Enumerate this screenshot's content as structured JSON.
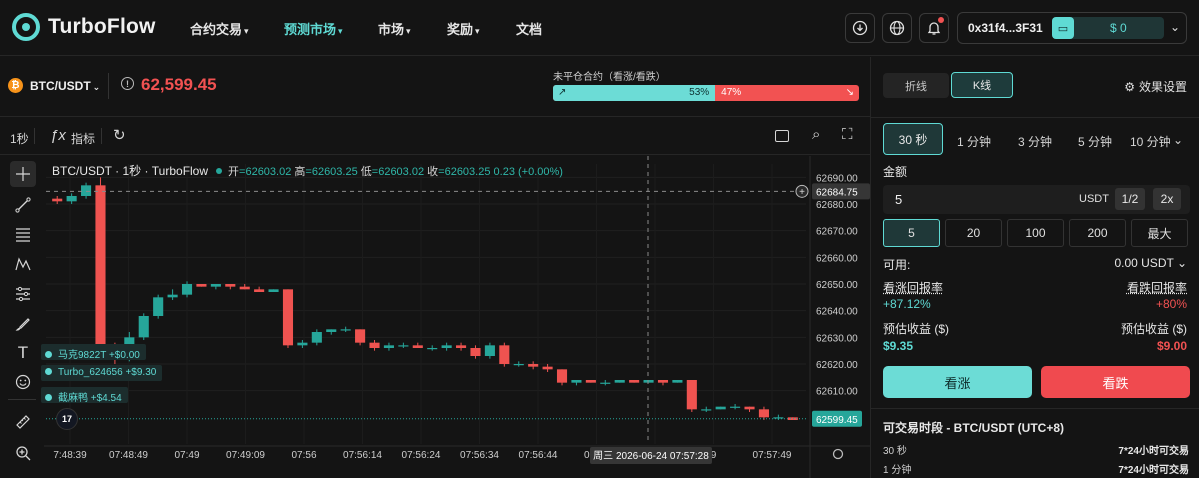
{
  "nav": {
    "brand": "TurboFlow",
    "items": [
      {
        "label": "合约交易",
        "caret": "▾"
      },
      {
        "label": "预测市场",
        "caret": "▾"
      },
      {
        "label": "市场",
        "caret": "▾"
      },
      {
        "label": "奖励",
        "caret": "▾"
      },
      {
        "label": "文档",
        "caret": ""
      }
    ],
    "active_index": 1,
    "wallet": {
      "address": "0x31f4...3F31",
      "balance": "$ 0"
    }
  },
  "symbol": {
    "name": "BTC/USDT",
    "price": "62,599.45",
    "coin_glyph": "₿"
  },
  "open_interest": {
    "label": "未平仓合约（看涨/看跌）",
    "up_pct_text": "53%",
    "down_pct_text": "47%",
    "up_fraction": 0.53
  },
  "chart_toolbar": {
    "interval": "1秒",
    "indicators": "指标"
  },
  "legend": {
    "title": "BTC/USDT · 1秒 · TurboFlow",
    "open_k": "开",
    "open_v": "=62603.02",
    "high_k": "高",
    "high_v": "=62603.25",
    "low_k": "低",
    "low_v": "=62603.02",
    "close_k": "收",
    "close_v": "=62603.25",
    "change": "0.23 (+0.00%)"
  },
  "trade_tags": [
    {
      "text": "马克9822T +$0.00"
    },
    {
      "text": "Turbo_624656 +$9.30"
    },
    {
      "text": "截麻鸭 +$4.54"
    }
  ],
  "chart_data": {
    "type": "candlestick",
    "ylim": [
      62590,
      62695
    ],
    "y_ticks": [
      62690,
      62680,
      62670,
      62660,
      62650,
      62640,
      62630,
      62620,
      62610
    ],
    "crosshair_value": "62684.75",
    "last_price_label": "62599.45",
    "last_price": 62599.45,
    "x_ticks": [
      "7:48:39",
      "07:48:49",
      "07:49",
      "07:49:09",
      "07:56",
      "07:56:14",
      "07:56:24",
      "07:56:34",
      "07:56:44",
      "07:57",
      "07:57:09",
      "9",
      "07:57:49"
    ],
    "crosshair_time": "周三 2026-06-24 07:57:28",
    "candles": [
      [
        62682,
        62683,
        62680,
        62681
      ],
      [
        62681,
        62684,
        62680,
        62683
      ],
      [
        62683,
        62688,
        62682,
        62687
      ],
      [
        62687,
        62690,
        62625,
        62627
      ],
      [
        62627,
        62628,
        62620,
        62622
      ],
      [
        62622,
        62632,
        62621,
        62630
      ],
      [
        62630,
        62639,
        62629,
        62638
      ],
      [
        62638,
        62646,
        62637,
        62645
      ],
      [
        62645,
        62648,
        62644,
        62646
      ],
      [
        62646,
        62651,
        62645,
        62650
      ],
      [
        62650,
        62650,
        62649,
        62649
      ],
      [
        62649,
        62650,
        62648,
        62650
      ],
      [
        62650,
        62650,
        62648,
        62649
      ],
      [
        62649,
        62650,
        62648,
        62648
      ],
      [
        62648,
        62649,
        62647,
        62647
      ],
      [
        62647,
        62648,
        62647,
        62648
      ],
      [
        62648,
        62648,
        62626,
        62627
      ],
      [
        62627,
        62629,
        62626,
        62628
      ],
      [
        62628,
        62633,
        62627,
        62632
      ],
      [
        62632,
        62633,
        62631,
        62633
      ],
      [
        62633,
        62634,
        62632,
        62633
      ],
      [
        62633,
        62633,
        62627,
        62628
      ],
      [
        62628,
        62629,
        62625,
        62626
      ],
      [
        62626,
        62628,
        62625,
        62627
      ],
      [
        62627,
        62628,
        62626,
        62627
      ],
      [
        62627,
        62628,
        62626,
        62626
      ],
      [
        62626,
        62627,
        62625,
        62626
      ],
      [
        62626,
        62628,
        62625,
        62627
      ],
      [
        62627,
        62628,
        62625,
        62626
      ],
      [
        62626,
        62627,
        62622,
        62623
      ],
      [
        62623,
        62628,
        62622,
        62627
      ],
      [
        62627,
        62628,
        62619,
        62620
      ],
      [
        62620,
        62621,
        62619,
        62620
      ],
      [
        62620,
        62621,
        62618,
        62619
      ],
      [
        62619,
        62620,
        62617,
        62618
      ],
      [
        62618,
        62618,
        62612,
        62613
      ],
      [
        62613,
        62614,
        62612,
        62614
      ],
      [
        62614,
        62614,
        62613,
        62613
      ],
      [
        62613,
        62614,
        62612,
        62613
      ],
      [
        62613,
        62614,
        62613,
        62614
      ],
      [
        62614,
        62614,
        62613,
        62613
      ],
      [
        62613,
        62614,
        62613,
        62614
      ],
      [
        62614,
        62614,
        62612,
        62613
      ],
      [
        62613,
        62614,
        62613,
        62614
      ],
      [
        62614,
        62614,
        62602,
        62603
      ],
      [
        62603,
        62604,
        62602,
        62603
      ],
      [
        62603,
        62604,
        62603,
        62604
      ],
      [
        62604,
        62605,
        62603,
        62604
      ],
      [
        62604,
        62604,
        62602,
        62603
      ],
      [
        62603,
        62604,
        62599,
        62600
      ],
      [
        62600,
        62601,
        62599,
        62600
      ],
      [
        62600,
        62600,
        62599,
        62599
      ]
    ]
  },
  "panel": {
    "view_line": "折线",
    "view_k": "K线",
    "settings": "效果设置",
    "timeframes": [
      "30 秒",
      "1 分钟",
      "3 分钟",
      "5 分钟",
      "10 分钟"
    ],
    "amount_label": "金额",
    "amount_value": "5",
    "amount_unit": "USDT",
    "half": "1/2",
    "double": "2x",
    "presets": [
      "5",
      "20",
      "100",
      "200",
      "最大"
    ],
    "available_label": "可用:",
    "available_value": "0.00 USDT",
    "up_return_label": "看涨回报率",
    "up_return_value": "+87.12%",
    "down_return_label": "看跌回报率",
    "down_return_value": "+80%",
    "est_label": "预估收益 ($)",
    "up_est": "$9.35",
    "down_est": "$9.00",
    "buy_up": "看涨",
    "buy_down": "看跌",
    "trade_hours_title": "可交易时段 - BTC/USDT (UTC+8)",
    "trade_hours": [
      {
        "tf": "30 秒",
        "hours": "7*24小时可交易"
      },
      {
        "tf": "1 分钟",
        "hours": "7*24小时可交易"
      }
    ]
  }
}
